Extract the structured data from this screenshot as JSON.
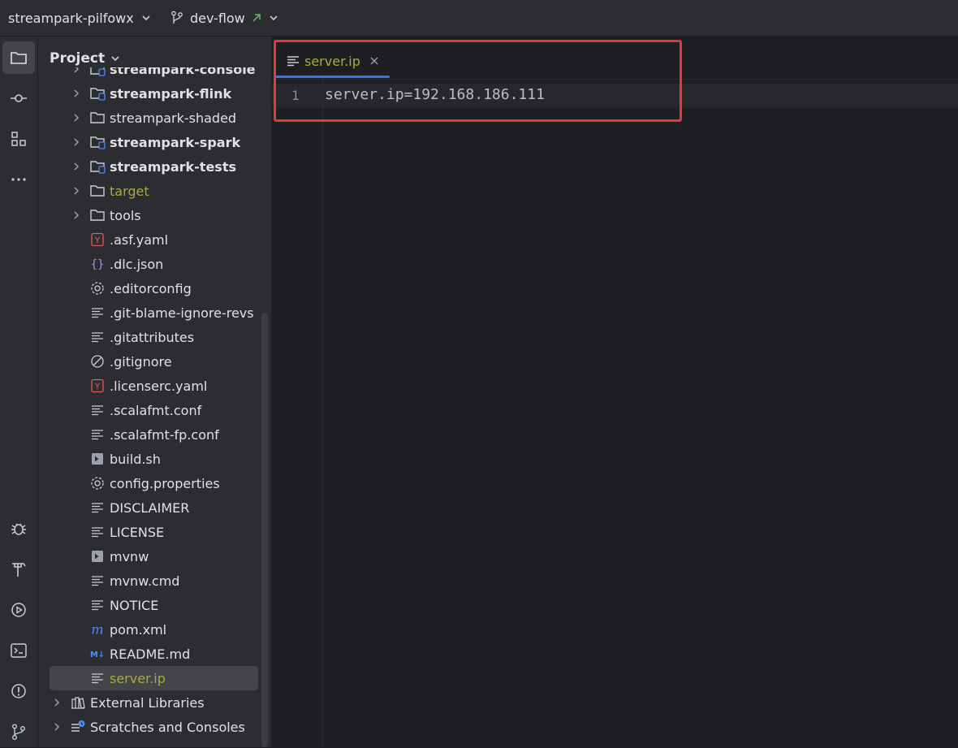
{
  "titlebar": {
    "project_name": "streampark-pilfowx",
    "branch_name": "dev-flow"
  },
  "project_panel": {
    "title": "Project",
    "tree": [
      {
        "label": "streampark-console",
        "type": "module",
        "bold": true,
        "expandable": true
      },
      {
        "label": "streampark-flink",
        "type": "module",
        "bold": true,
        "expandable": true
      },
      {
        "label": "streampark-shaded",
        "type": "folder",
        "bold": false,
        "expandable": true
      },
      {
        "label": "streampark-spark",
        "type": "module",
        "bold": true,
        "expandable": true
      },
      {
        "label": "streampark-tests",
        "type": "module",
        "bold": true,
        "expandable": true
      },
      {
        "label": "target",
        "type": "folder-excluded",
        "bold": false,
        "expandable": true
      },
      {
        "label": "tools",
        "type": "folder",
        "bold": false,
        "expandable": true
      },
      {
        "label": ".asf.yaml",
        "type": "yaml"
      },
      {
        "label": ".dlc.json",
        "type": "json"
      },
      {
        "label": ".editorconfig",
        "type": "config"
      },
      {
        "label": ".git-blame-ignore-revs",
        "type": "text"
      },
      {
        "label": ".gitattributes",
        "type": "text"
      },
      {
        "label": ".gitignore",
        "type": "ignore"
      },
      {
        "label": ".licenserc.yaml",
        "type": "yaml"
      },
      {
        "label": ".scalafmt.conf",
        "type": "text"
      },
      {
        "label": ".scalafmt-fp.conf",
        "type": "text"
      },
      {
        "label": "build.sh",
        "type": "shell"
      },
      {
        "label": "config.properties",
        "type": "config"
      },
      {
        "label": "DISCLAIMER",
        "type": "text"
      },
      {
        "label": "LICENSE",
        "type": "text"
      },
      {
        "label": "mvnw",
        "type": "shell"
      },
      {
        "label": "mvnw.cmd",
        "type": "text"
      },
      {
        "label": "NOTICE",
        "type": "text"
      },
      {
        "label": "pom.xml",
        "type": "maven"
      },
      {
        "label": "README.md",
        "type": "markdown"
      },
      {
        "label": "server.ip",
        "type": "text",
        "selected": true
      },
      {
        "label": "External Libraries",
        "type": "libraries",
        "expandable": true
      },
      {
        "label": "Scratches and Consoles",
        "type": "scratches",
        "expandable": true
      }
    ]
  },
  "editor": {
    "tab_label": "server.ip",
    "lines": [
      {
        "number": "1",
        "text": "server.ip=192.168.186.111"
      }
    ]
  },
  "colors": {
    "accent": "#3574f0",
    "modified_file": "#aca93b",
    "highlight_box": "#e53935",
    "branch_arrow": "#5fb865"
  }
}
